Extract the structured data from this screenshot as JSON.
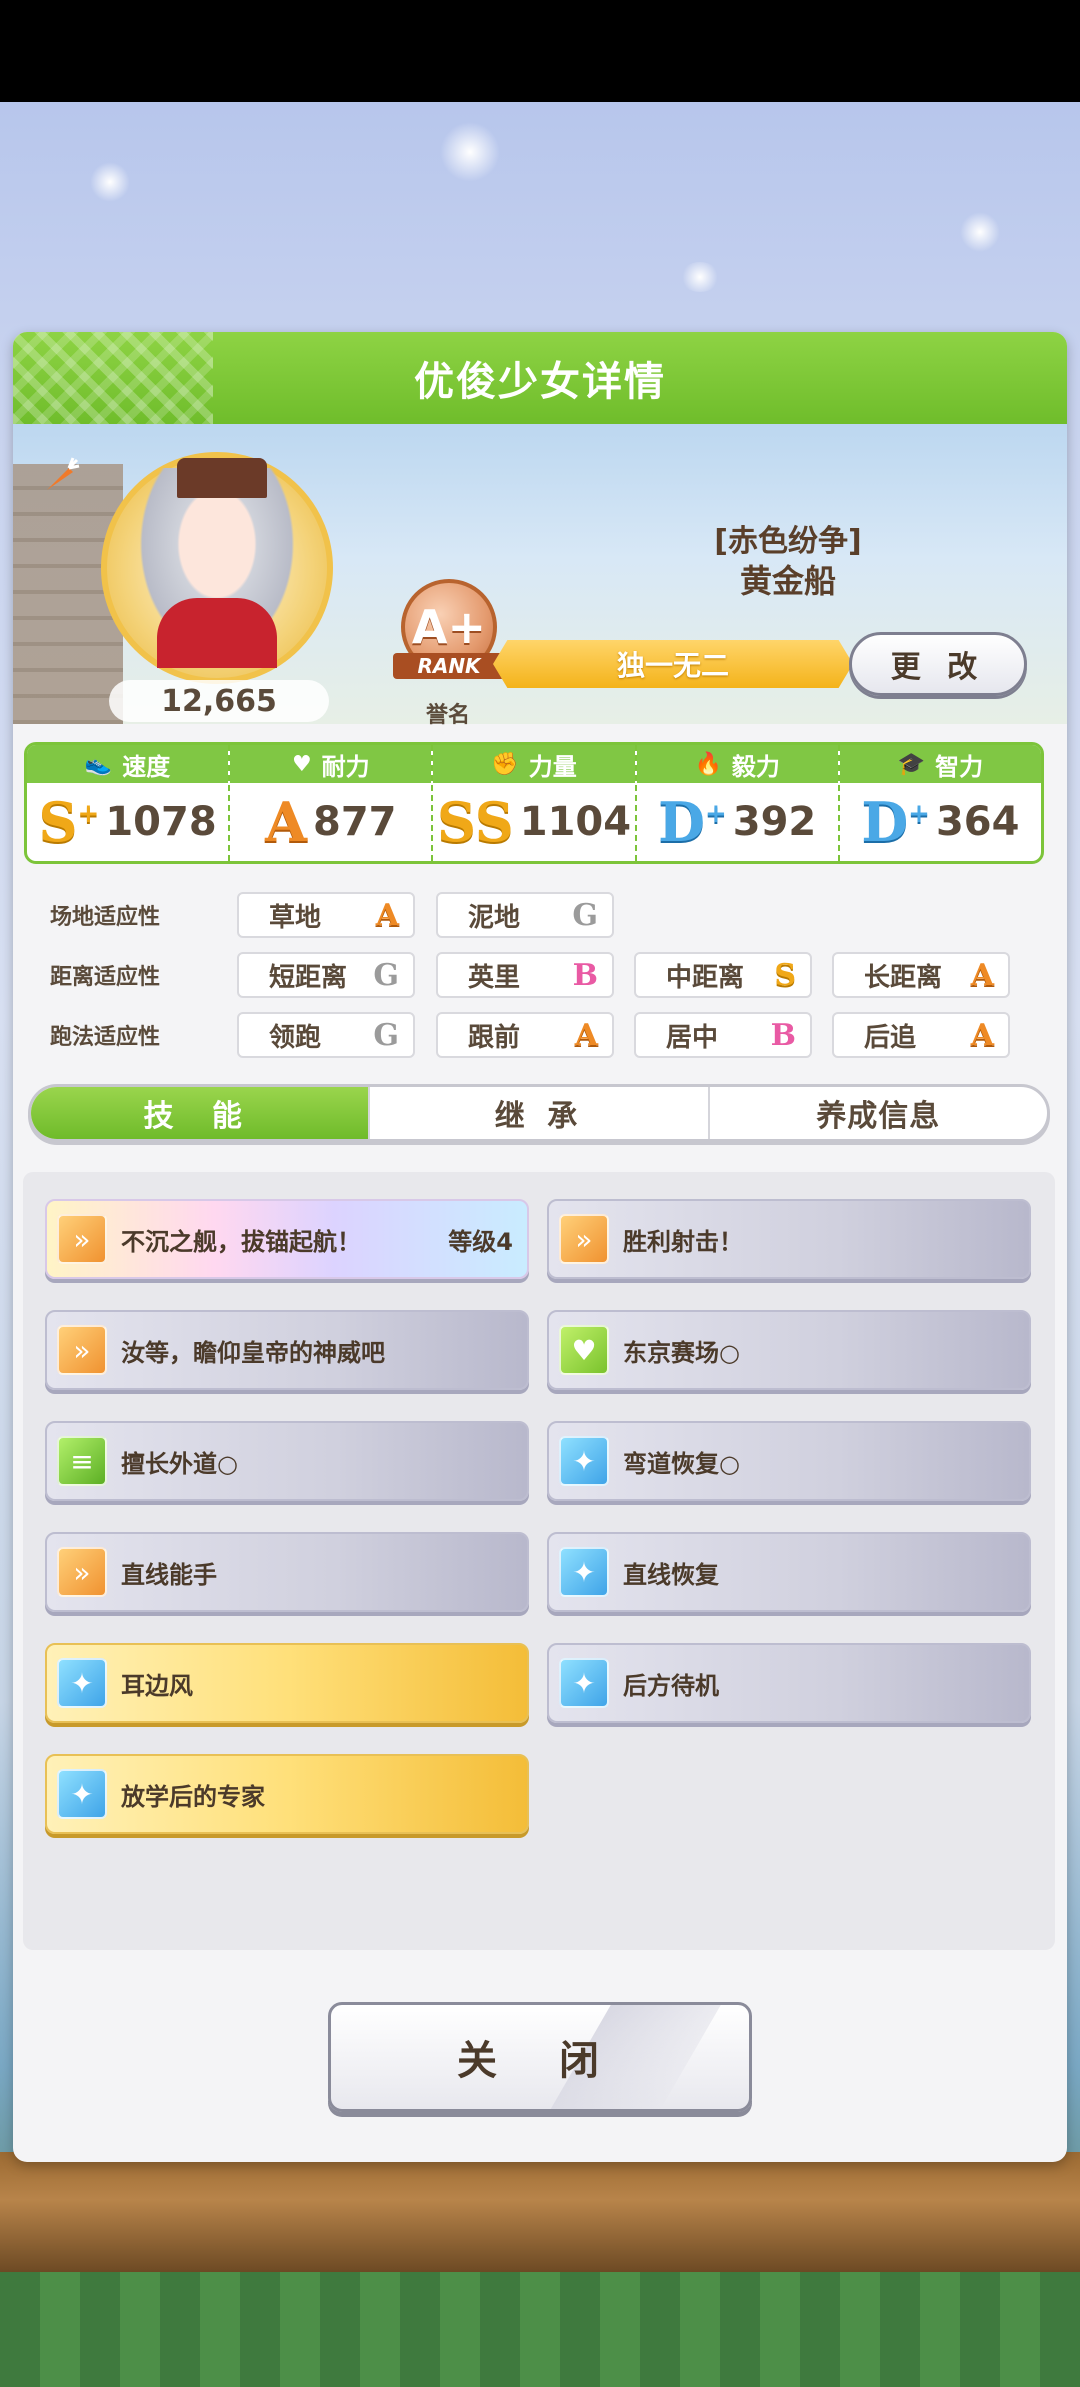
{
  "header": {
    "title": "优俊少女详情"
  },
  "profile": {
    "fans": "12,665",
    "rank_letter": "A+",
    "rank_ribbon": "RANK",
    "rank_caption": "誉名",
    "epithet": "[赤色纷争]",
    "name": "黄金船",
    "title_banner": "独一无二",
    "change_label": "更 改"
  },
  "stats": [
    {
      "label": "速度",
      "grade": "S",
      "plus": "+",
      "value": "1078",
      "icon": "shoe-icon"
    },
    {
      "label": "耐力",
      "grade": "A",
      "plus": "",
      "value": "877",
      "icon": "heart-icon"
    },
    {
      "label": "力量",
      "grade": "SS",
      "plus": "",
      "value": "1104",
      "icon": "muscle-icon"
    },
    {
      "label": "毅力",
      "grade": "D",
      "plus": "+",
      "value": "392",
      "icon": "flame-icon"
    },
    {
      "label": "智力",
      "grade": "D",
      "plus": "+",
      "value": "364",
      "icon": "cap-icon"
    }
  ],
  "aptitude": {
    "track_label": "场地适应性",
    "distance_label": "距离适应性",
    "style_label": "跑法适应性",
    "track": [
      {
        "name": "草地",
        "grade": "A"
      },
      {
        "name": "泥地",
        "grade": "G"
      }
    ],
    "distance": [
      {
        "name": "短距离",
        "grade": "G"
      },
      {
        "name": "英里",
        "grade": "B"
      },
      {
        "name": "中距离",
        "grade": "S"
      },
      {
        "name": "长距离",
        "grade": "A"
      }
    ],
    "style": [
      {
        "name": "领跑",
        "grade": "G"
      },
      {
        "name": "跟前",
        "grade": "A"
      },
      {
        "name": "居中",
        "grade": "B"
      },
      {
        "name": "后追",
        "grade": "A"
      }
    ]
  },
  "tabs": [
    {
      "label": "技 能"
    },
    {
      "label": "继 承"
    },
    {
      "label": "养成信息"
    }
  ],
  "skills": [
    {
      "name": "不沉之舰，拔锚起航！",
      "level": "等级4",
      "icon": "speed-icon",
      "style": "rainbow"
    },
    {
      "name": "胜利射击！",
      "level": "",
      "icon": "speed-icon",
      "style": "normal"
    },
    {
      "name": "汝等，瞻仰皇帝的神威吧",
      "level": "",
      "icon": "speed-icon",
      "style": "normal"
    },
    {
      "name": "东京赛场○",
      "level": "",
      "icon": "heart-icon",
      "style": "normal"
    },
    {
      "name": "擅长外道○",
      "level": "",
      "icon": "document-icon",
      "style": "normal"
    },
    {
      "name": "弯道恢复○",
      "level": "",
      "icon": "recover-icon",
      "style": "normal"
    },
    {
      "name": "直线能手",
      "level": "",
      "icon": "speed-icon",
      "style": "normal"
    },
    {
      "name": "直线恢复",
      "level": "",
      "icon": "recover-icon",
      "style": "normal"
    },
    {
      "name": "耳边风",
      "level": "",
      "icon": "recover-icon",
      "style": "gold"
    },
    {
      "name": "后方待机",
      "level": "",
      "icon": "recover-icon",
      "style": "normal"
    },
    {
      "name": "放学后的专家",
      "level": "",
      "icon": "recover-icon",
      "style": "gold"
    }
  ],
  "footer": {
    "close_label": "关 闭"
  },
  "colors": {
    "accent_green": "#7cc43a",
    "gold": "#f4b31a"
  }
}
